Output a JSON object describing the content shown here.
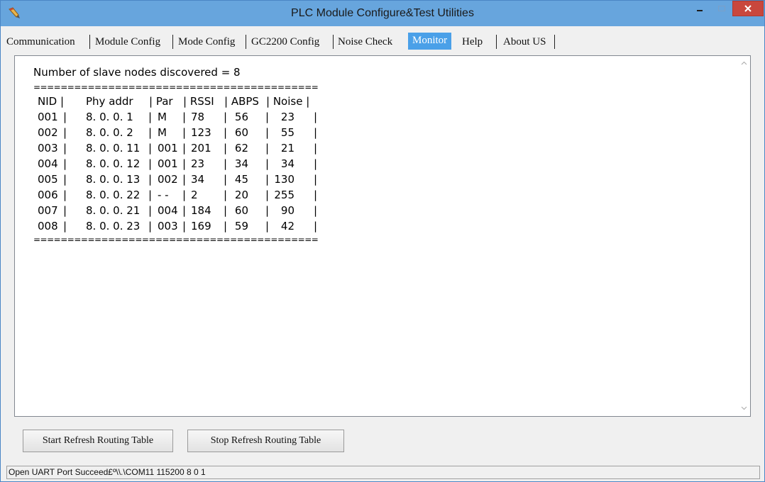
{
  "window": {
    "title": "PLC Module Configure&Test Utilities"
  },
  "tabs": [
    {
      "label": "Communication"
    },
    {
      "label": "Module Config"
    },
    {
      "label": "Mode Config"
    },
    {
      "label": "GC2200 Config"
    },
    {
      "label": "Noise Check"
    },
    {
      "label": "Monitor",
      "active": true
    },
    {
      "label": "Help"
    },
    {
      "label": "About US"
    }
  ],
  "monitor": {
    "summary": "Number of slave nodes discovered = 8",
    "separator": "==========================================",
    "columns": [
      "NID |",
      "Phy addr",
      "| Par",
      "| RSSI",
      "| ABPS",
      "| Noise |"
    ],
    "rows": [
      {
        "nid": "001",
        "phy": "8. 0. 0. 1",
        "par": "M",
        "rssi": "78",
        "abps": "56",
        "noise": "23"
      },
      {
        "nid": "002",
        "phy": "8. 0. 0. 2",
        "par": "M",
        "rssi": "123",
        "abps": "60",
        "noise": "55"
      },
      {
        "nid": "003",
        "phy": "8. 0. 0. 11",
        "par": "001",
        "rssi": "201",
        "abps": "62",
        "noise": "21"
      },
      {
        "nid": "004",
        "phy": "8. 0. 0. 12",
        "par": "001",
        "rssi": "23",
        "abps": "34",
        "noise": "34"
      },
      {
        "nid": "005",
        "phy": "8. 0. 0. 13",
        "par": "002",
        "rssi": "34",
        "abps": "45",
        "noise": "130"
      },
      {
        "nid": "006",
        "phy": "8. 0. 0. 22",
        "par": "- -",
        "rssi": "2",
        "abps": "20",
        "noise": "255"
      },
      {
        "nid": "007",
        "phy": "8. 0. 0. 21",
        "par": "004",
        "rssi": "184",
        "abps": "60",
        "noise": "90"
      },
      {
        "nid": "008",
        "phy": "8. 0. 0. 23",
        "par": "003",
        "rssi": "169",
        "abps": "59",
        "noise": "42"
      }
    ]
  },
  "buttons": {
    "start": "Start Refresh Routing Table",
    "stop": "Stop Refresh Routing Table"
  },
  "status": {
    "text": "Open UART Port Succeed£º\\\\.\\COM11 115200 8 0 1"
  },
  "colors": {
    "titlebar": "#67a5dd",
    "active_tab": "#4aa0e8",
    "close_button": "#c9473d"
  },
  "icons": {
    "app": "pencil-icon",
    "minimize": "minimize-icon",
    "maximize": "maximize-icon",
    "close": "close-icon",
    "scroll_up": "chevron-up-icon",
    "scroll_down": "chevron-down-icon"
  }
}
